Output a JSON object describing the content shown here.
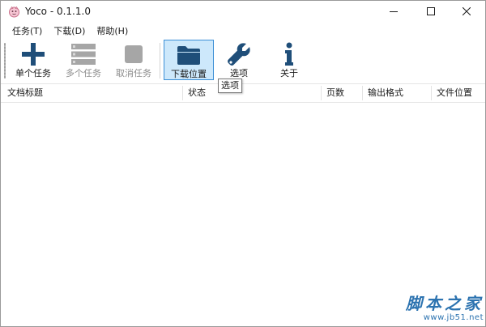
{
  "window": {
    "title": "Yoco - 0.1.1.0",
    "controls": {
      "minimize_icon": "minimize-icon",
      "maximize_icon": "maximize-icon",
      "close_icon": "close-icon"
    }
  },
  "menu": {
    "items": [
      {
        "label": "任务(T)"
      },
      {
        "label": "下载(D)"
      },
      {
        "label": "帮助(H)"
      }
    ]
  },
  "toolbar": {
    "buttons": [
      {
        "label": "单个任务",
        "icon": "plus-icon",
        "enabled": true
      },
      {
        "label": "多个任务",
        "icon": "list-icon",
        "enabled": false
      },
      {
        "label": "取消任务",
        "icon": "stop-icon",
        "enabled": false
      },
      {
        "label": "下载位置",
        "icon": "folder-icon",
        "enabled": true,
        "active": true
      },
      {
        "label": "选项",
        "icon": "wrench-icon",
        "enabled": true
      },
      {
        "label": "关于",
        "icon": "info-icon",
        "enabled": true
      }
    ],
    "tooltip": "选项"
  },
  "table": {
    "columns": [
      "文档标题",
      "状态",
      "页数",
      "输出格式",
      "文件位置"
    ],
    "rows": []
  },
  "watermark": {
    "text": "脚本之家",
    "url": "www.jb51.net"
  },
  "colors": {
    "accent": "#2c73b0",
    "active_bg": "#cde8fb",
    "active_border": "#3c8fd6",
    "icon_dark": "#1f4e79",
    "icon_disabled": "#a6a6a6"
  }
}
